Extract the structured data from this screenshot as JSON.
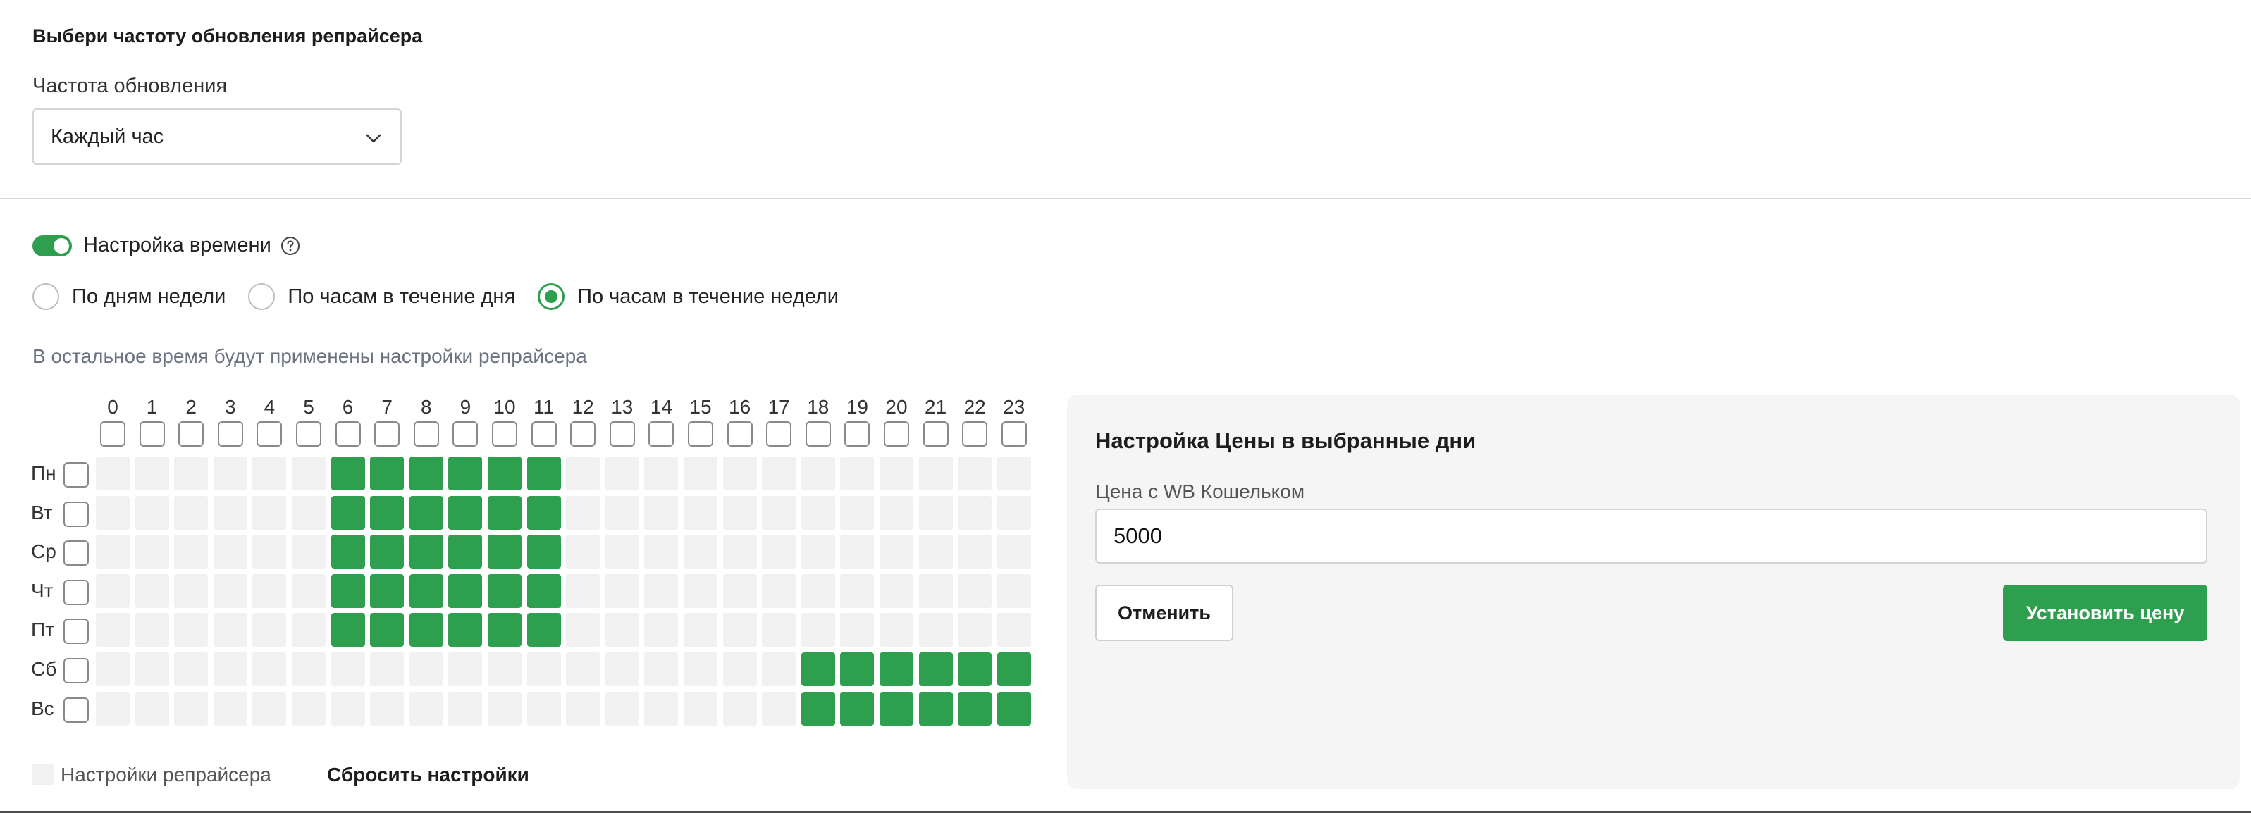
{
  "frequency": {
    "title": "Выбери частоту обновления репрайсера",
    "label": "Частота обновления",
    "selected": "Каждый час"
  },
  "time_settings": {
    "toggle_label": "Настройка времени",
    "toggle_on": true,
    "help_icon": "question-circle-icon",
    "modes": [
      {
        "label": "По дням недели",
        "checked": false
      },
      {
        "label": "По часам в течение дня",
        "checked": false
      },
      {
        "label": "По часам в течение недели",
        "checked": true
      }
    ],
    "hint": "В остальное время будут применены настройки репрайсера"
  },
  "schedule": {
    "hours": [
      "0",
      "1",
      "2",
      "3",
      "4",
      "5",
      "6",
      "7",
      "8",
      "9",
      "10",
      "11",
      "12",
      "13",
      "14",
      "15",
      "16",
      "17",
      "18",
      "19",
      "20",
      "21",
      "22",
      "23"
    ],
    "days": [
      "Пн",
      "Вт",
      "Ср",
      "Чт",
      "Пт",
      "Сб",
      "Вс"
    ],
    "selected": {
      "Пн": [
        6,
        7,
        8,
        9,
        10,
        11
      ],
      "Вт": [
        6,
        7,
        8,
        9,
        10,
        11
      ],
      "Ср": [
        6,
        7,
        8,
        9,
        10,
        11
      ],
      "Чт": [
        6,
        7,
        8,
        9,
        10,
        11
      ],
      "Пт": [
        6,
        7,
        8,
        9,
        10,
        11
      ],
      "Сб": [
        18,
        19,
        20,
        21,
        22,
        23
      ],
      "Вс": [
        18,
        19,
        20,
        21,
        22,
        23
      ]
    },
    "legend_label": "Настройки репрайсера",
    "reset_label": "Сбросить настройки"
  },
  "price_panel": {
    "title": "Настройка Цены в выбранные дни",
    "price_label": "Цена с WB Кошельком",
    "price_value": "5000",
    "cancel_label": "Отменить",
    "submit_label": "Установить цену"
  },
  "colors": {
    "accent": "#2e9e4f",
    "cell_empty": "#f1f1f1"
  }
}
